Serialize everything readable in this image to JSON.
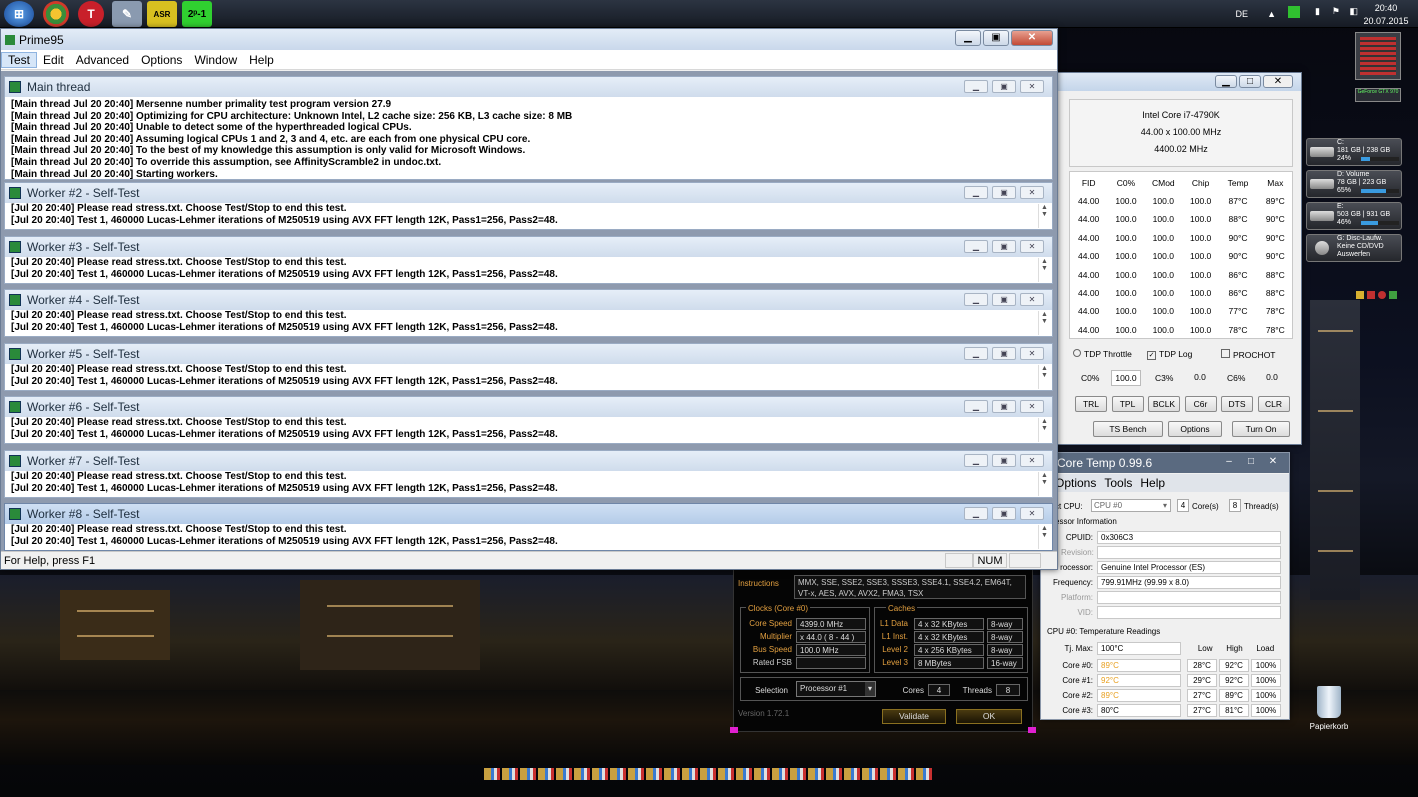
{
  "taskbar": {
    "time": "20:40",
    "date": "20.07.2015",
    "icons": [
      "windows-orb-icon",
      "chrome-icon",
      "t-app-icon",
      "tool-icon",
      "asrock-icon",
      "prime-icon"
    ],
    "lang": "DE"
  },
  "prime95": {
    "title": "Prime95",
    "menu": [
      "Test",
      "Edit",
      "Advanced",
      "Options",
      "Window",
      "Help"
    ],
    "main_thread": {
      "title": "Main thread",
      "lines": [
        "[Main thread Jul 20 20:40] Mersenne number primality test program version 27.9",
        "[Main thread Jul 20 20:40] Optimizing for CPU architecture: Unknown Intel, L2 cache size: 256 KB, L3 cache size: 8 MB",
        "[Main thread Jul 20 20:40] Unable to detect some of the hyperthreaded logical CPUs.",
        "[Main thread Jul 20 20:40] Assuming logical CPUs 1 and 2, 3 and 4, etc. are each from one physical CPU core.",
        "[Main thread Jul 20 20:40] To the best of my knowledge this assumption is only valid for Microsoft Windows.",
        "[Main thread Jul 20 20:40] To override this assumption, see AffinityScramble2 in undoc.txt.",
        "[Main thread Jul 20 20:40] Starting workers."
      ]
    },
    "workers": [
      {
        "title": "Worker #2 - Self-Test",
        "line1": "[Jul 20 20:40] Please read stress.txt.  Choose Test/Stop to end this test.",
        "line2": "[Jul 20 20:40] Test 1, 460000 Lucas-Lehmer iterations of M250519 using AVX FFT length 12K, Pass1=256, Pass2=48."
      },
      {
        "title": "Worker #3 - Self-Test",
        "line1": "[Jul 20 20:40] Please read stress.txt.  Choose Test/Stop to end this test.",
        "line2": "[Jul 20 20:40] Test 1, 460000 Lucas-Lehmer iterations of M250519 using AVX FFT length 12K, Pass1=256, Pass2=48."
      },
      {
        "title": "Worker #4 - Self-Test",
        "line1": "[Jul 20 20:40] Please read stress.txt.  Choose Test/Stop to end this test.",
        "line2": "[Jul 20 20:40] Test 1, 460000 Lucas-Lehmer iterations of M250519 using AVX FFT length 12K, Pass1=256, Pass2=48."
      },
      {
        "title": "Worker #5 - Self-Test",
        "line1": "[Jul 20 20:40] Please read stress.txt.  Choose Test/Stop to end this test.",
        "line2": "[Jul 20 20:40] Test 1, 460000 Lucas-Lehmer iterations of M250519 using AVX FFT length 12K, Pass1=256, Pass2=48."
      },
      {
        "title": "Worker #6 - Self-Test",
        "line1": "[Jul 20 20:40] Please read stress.txt.  Choose Test/Stop to end this test.",
        "line2": "[Jul 20 20:40] Test 1, 460000 Lucas-Lehmer iterations of M250519 using AVX FFT length 12K, Pass1=256, Pass2=48."
      },
      {
        "title": "Worker #7 - Self-Test",
        "line1": "[Jul 20 20:40] Please read stress.txt.  Choose Test/Stop to end this test.",
        "line2": "[Jul 20 20:40] Test 1, 460000 Lucas-Lehmer iterations of M250519 using AVX FFT length 12K, Pass1=256, Pass2=48."
      },
      {
        "title": "Worker #8 - Self-Test",
        "line1": "[Jul 20 20:40] Please read stress.txt.  Choose Test/Stop to end this test.",
        "line2": "[Jul 20 20:40] Test 1, 460000 Lucas-Lehmer iterations of M250519 using AVX FFT length 12K, Pass1=256, Pass2=48."
      }
    ],
    "status": "For Help, press F1",
    "num": "NUM"
  },
  "throttlestop": {
    "cpu": "Intel Core i7-4790K",
    "mult": "44.00 x 100.00 MHz",
    "freq": "4400.02 MHz",
    "headers": [
      "FID",
      "C0%",
      "CMod",
      "Chip",
      "Temp",
      "Max"
    ],
    "rows": [
      [
        "44.00",
        "100.0",
        "100.0",
        "100.0",
        "87°C",
        "89°C"
      ],
      [
        "44.00",
        "100.0",
        "100.0",
        "100.0",
        "88°C",
        "90°C"
      ],
      [
        "44.00",
        "100.0",
        "100.0",
        "100.0",
        "90°C",
        "90°C"
      ],
      [
        "44.00",
        "100.0",
        "100.0",
        "100.0",
        "90°C",
        "90°C"
      ],
      [
        "44.00",
        "100.0",
        "100.0",
        "100.0",
        "86°C",
        "88°C"
      ],
      [
        "44.00",
        "100.0",
        "100.0",
        "100.0",
        "86°C",
        "88°C"
      ],
      [
        "44.00",
        "100.0",
        "100.0",
        "100.0",
        "77°C",
        "78°C"
      ],
      [
        "44.00",
        "100.0",
        "100.0",
        "100.0",
        "78°C",
        "78°C"
      ]
    ],
    "tdp_throttle": "TDP Throttle",
    "tdp_log": "TDP Log",
    "prochot": "PROCHOT",
    "c0_label": "C0%",
    "c0_val": "100.0",
    "c3_label": "C3%",
    "c3_val": "0.0",
    "c6_label": "C6%",
    "c6_val": "0.0",
    "buttons1": [
      "TRL",
      "TPL",
      "BCLK",
      "C6r",
      "DTS",
      "CLR"
    ],
    "buttons2": [
      "TS Bench",
      "Options",
      "Turn On"
    ]
  },
  "coretemp": {
    "title": "Core Temp 0.99.6",
    "menu": [
      "Options",
      "Tools",
      "Help"
    ],
    "select_label": "ct CPU:",
    "cpu_select": "CPU #0",
    "cores": "4",
    "cores_label": "Core(s)",
    "threads": "8",
    "threads_label": "Thread(s)",
    "proc_info": "essor Information",
    "cpuid_label": "CPUID:",
    "cpuid": "0x306C3",
    "revision_label": "Revision:",
    "processor_label": "rocessor:",
    "processor": "Genuine Intel Processor (ES)",
    "frequency_label": "Frequency:",
    "frequency": "799.91MHz (99.99 x 8.0)",
    "platform_label": "Platform:",
    "vid_label": "VID:",
    "temp_header": "CPU #0: Temperature Readings",
    "tjmax_label": "Tj. Max:",
    "tjmax": "100°C",
    "cols": [
      "Low",
      "High",
      "Load"
    ],
    "cores_rows": [
      {
        "name": "Core #0:",
        "cur": "89°C",
        "low": "28°C",
        "high": "92°C",
        "load": "100%"
      },
      {
        "name": "Core #1:",
        "cur": "92°C",
        "low": "29°C",
        "high": "92°C",
        "load": "100%"
      },
      {
        "name": "Core #2:",
        "cur": "89°C",
        "low": "27°C",
        "high": "89°C",
        "load": "100%"
      },
      {
        "name": "Core #3:",
        "cur": "80°C",
        "low": "27°C",
        "high": "81°C",
        "load": "100%"
      }
    ]
  },
  "cpuz": {
    "instructions_label": "Instructions",
    "instructions": "MMX, SSE, SSE2, SSE3, SSSE3, SSE4.1, SSE4.2, EM64T, VT-x, AES, AVX, AVX2, FMA3, TSX",
    "clocks_title": "Clocks (Core #0)",
    "caches_title": "Caches",
    "core_speed_label": "Core Speed",
    "core_speed": "4399.0 MHz",
    "multiplier_label": "Multiplier",
    "multiplier": "x 44.0 ( 8 - 44 )",
    "bus_speed_label": "Bus Speed",
    "bus_speed": "100.0 MHz",
    "rated_fsb_label": "Rated FSB",
    "rated_fsb": "",
    "l1d_label": "L1 Data",
    "l1d": "4 x 32 KBytes",
    "l1d_way": "8-way",
    "l1i_label": "L1 Inst.",
    "l1i": "4 x 32 KBytes",
    "l1i_way": "8-way",
    "l2_label": "Level 2",
    "l2": "4 x 256 KBytes",
    "l2_way": "8-way",
    "l3_label": "Level 3",
    "l3": "8 MBytes",
    "l3_way": "16-way",
    "selection_label": "Selection",
    "selection": "Processor #1",
    "cores_label": "Cores",
    "cores": "4",
    "threads_label": "Threads",
    "threads": "8",
    "version": "Version 1.72.1",
    "validate": "Validate",
    "ok": "OK"
  },
  "gadgets": [
    {
      "name": "C:",
      "size": "181 GB | 238 GB",
      "pct": "24%",
      "fill": 0.24
    },
    {
      "name": "D: Volume",
      "size": "78 GB | 223 GB",
      "pct": "65%",
      "fill": 0.65
    },
    {
      "name": "E:",
      "size": "503 GB | 931 GB",
      "pct": "46%",
      "fill": 0.46
    }
  ],
  "dvd_gadget": {
    "name": "G: Disc-Laufw.",
    "line2": "Keine CD/DVD",
    "line3": "Auswerfen"
  },
  "gpu_gadget": "GeForce GTX 970",
  "recycle_bin": "Papierkorb"
}
